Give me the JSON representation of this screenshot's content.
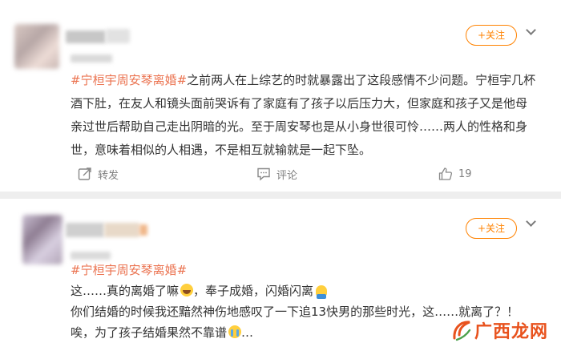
{
  "posts": [
    {
      "follow_label": "+关注",
      "hashtag": "#宁桓宇周安琴离婚#",
      "lines": [
        "之前两人在上综艺的时就暴露出了这段感情不少问题。宁桓宇几杯",
        "酒下肚，在友人和镜头面前哭诉有了家庭有了孩子以后压力大，但家庭和孩子又是他母",
        "亲过世后帮助自己走出阴暗的光。至于周安琴也是从小身世很可怜……两人的性格和身",
        "世，意味着相似的人相遇，不是相互就输就是一起下坠。"
      ],
      "actions": {
        "repost_label": "转发",
        "comment_label": "评论",
        "like_count": "19"
      }
    },
    {
      "follow_label": "+关注",
      "hashtag": "#宁桓宇周安琴离婚#",
      "line1_a": "这……真的离婚了嘛",
      "line1_b": "，奉子成婚，闪婚闪离",
      "line2": "你们结婚的时候我还黯然神伤地感叹了一下追13快男的那些时光，这……就离了？！",
      "line3": "唉，为了孩子结婚果然不靠谱",
      "line3_end": "…"
    }
  ],
  "watermark": {
    "text": "广西龙网"
  },
  "colors": {
    "accent": "#ff8200",
    "hashtag": "#eb7350",
    "watermark": "#e8521d"
  }
}
